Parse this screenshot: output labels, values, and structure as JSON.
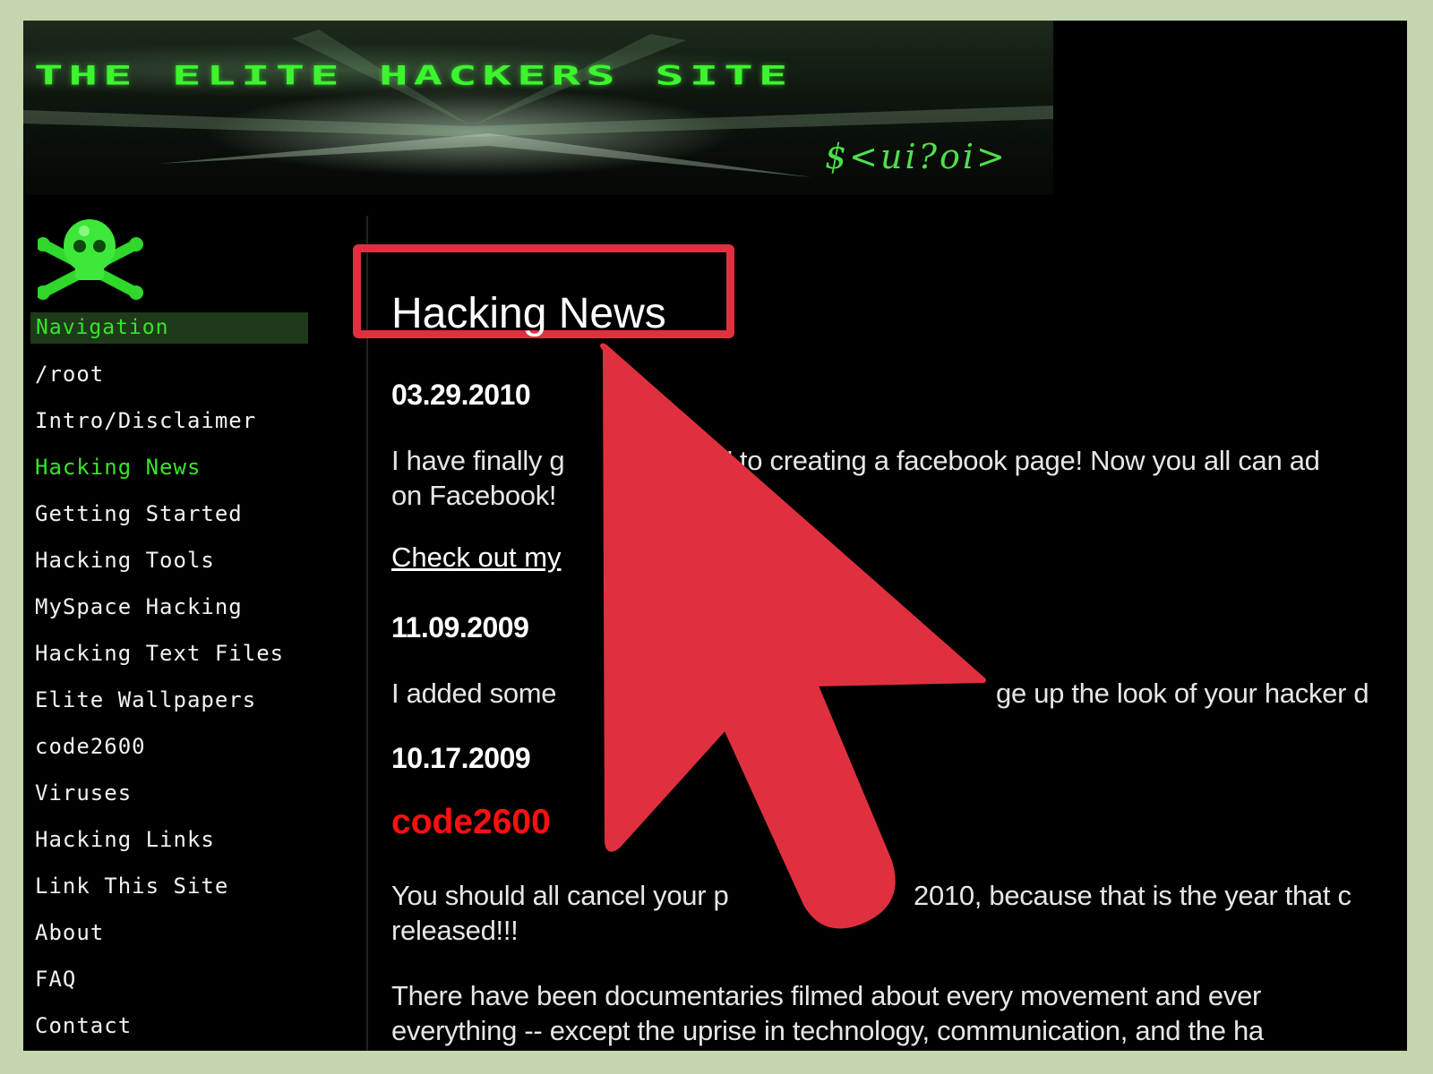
{
  "header": {
    "site_title": "THE ELITE HACKERS SITE",
    "signature": "$<ui?oi>"
  },
  "sidebar": {
    "nav_header": "Navigation",
    "items": [
      {
        "label": "/root"
      },
      {
        "label": "Intro/Disclaimer"
      },
      {
        "label": "Hacking News",
        "active": true
      },
      {
        "label": "Getting Started"
      },
      {
        "label": "Hacking Tools"
      },
      {
        "label": "MySpace Hacking"
      },
      {
        "label": "Hacking Text Files"
      },
      {
        "label": "Elite Wallpapers"
      },
      {
        "label": "code2600"
      },
      {
        "label": "Viruses"
      },
      {
        "label": "Hacking Links"
      },
      {
        "label": "Link This Site"
      },
      {
        "label": "About"
      },
      {
        "label": "FAQ"
      },
      {
        "label": "Contact"
      }
    ]
  },
  "main": {
    "page_title": "Hacking News",
    "news": [
      {
        "date": "03.29.2010",
        "text_line1_left": "I have finally g",
        "text_line1_right": "' to creating a facebook page! Now you all can ad",
        "text_line2": "on Facebook!",
        "link_label": "Check out my"
      },
      {
        "date": "11.09.2009",
        "text_left": "I added some",
        "text_right": "ge up the look of your hacker d"
      },
      {
        "date": "10.17.2009",
        "heading": "code2600",
        "para1_line1_left": "You should all cancel your p",
        "para1_line1_right": "2010, because that is the year that c",
        "para1_line2": "released!!!",
        "para2_line1": "There have been documentaries filmed about every movement and ever",
        "para2_line2": "everything -- except the uprise in technology, communication, and the ha"
      }
    ]
  },
  "colors": {
    "frame_border": "#c3d6ad",
    "accent_green": "#37e52a",
    "annotation_red": "#e0303f",
    "heading_red": "#ff1010"
  },
  "icons": [
    "skull-crossbones-icon",
    "pointer-arrow-icon"
  ]
}
